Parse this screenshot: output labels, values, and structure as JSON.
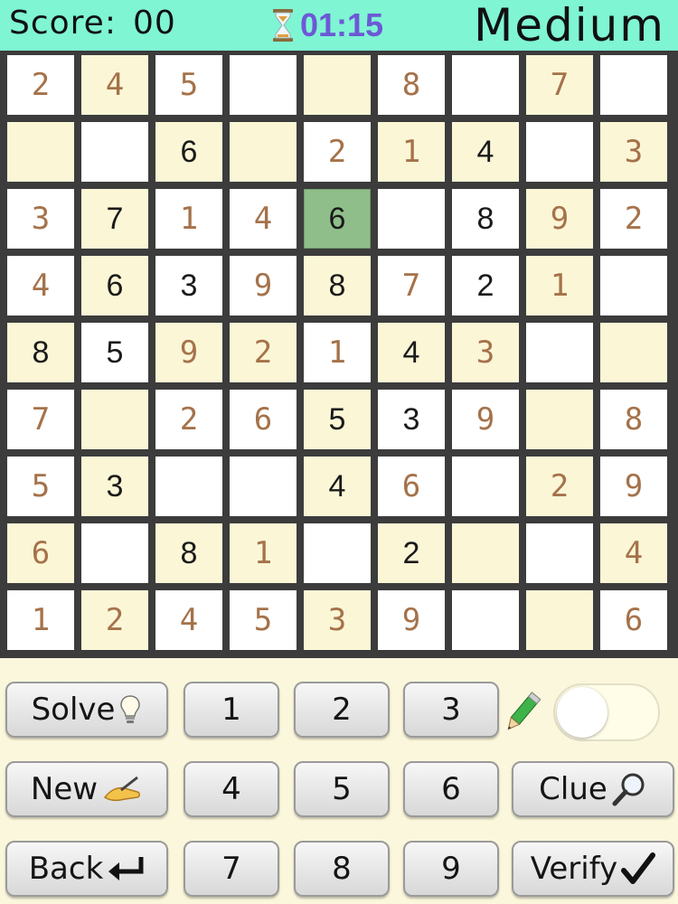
{
  "header": {
    "score_label": "Score:",
    "score_value": "00",
    "timer": "01:15",
    "difficulty": "Medium"
  },
  "board": {
    "rows": [
      [
        {
          "v": "2",
          "t": "g"
        },
        {
          "v": "4",
          "t": "g"
        },
        {
          "v": "5",
          "t": "g"
        },
        {
          "v": "",
          "t": "e"
        },
        {
          "v": "",
          "t": "e"
        },
        {
          "v": "8",
          "t": "g"
        },
        {
          "v": "",
          "t": "e"
        },
        {
          "v": "7",
          "t": "g"
        },
        {
          "v": "",
          "t": "e"
        }
      ],
      [
        {
          "v": "",
          "t": "e"
        },
        {
          "v": "",
          "t": "e"
        },
        {
          "v": "6",
          "t": "u"
        },
        {
          "v": "",
          "t": "e"
        },
        {
          "v": "2",
          "t": "g"
        },
        {
          "v": "1",
          "t": "g"
        },
        {
          "v": "4",
          "t": "u"
        },
        {
          "v": "",
          "t": "e"
        },
        {
          "v": "3",
          "t": "g"
        }
      ],
      [
        {
          "v": "3",
          "t": "g"
        },
        {
          "v": "7",
          "t": "u"
        },
        {
          "v": "1",
          "t": "g"
        },
        {
          "v": "4",
          "t": "g"
        },
        {
          "v": "6",
          "t": "u",
          "sel": true
        },
        {
          "v": "",
          "t": "e"
        },
        {
          "v": "8",
          "t": "u"
        },
        {
          "v": "9",
          "t": "g"
        },
        {
          "v": "2",
          "t": "g"
        }
      ],
      [
        {
          "v": "4",
          "t": "g"
        },
        {
          "v": "6",
          "t": "u"
        },
        {
          "v": "3",
          "t": "u"
        },
        {
          "v": "9",
          "t": "g"
        },
        {
          "v": "8",
          "t": "u"
        },
        {
          "v": "7",
          "t": "g"
        },
        {
          "v": "2",
          "t": "u"
        },
        {
          "v": "1",
          "t": "g"
        },
        {
          "v": "",
          "t": "e"
        }
      ],
      [
        {
          "v": "8",
          "t": "u"
        },
        {
          "v": "5",
          "t": "u"
        },
        {
          "v": "9",
          "t": "g"
        },
        {
          "v": "2",
          "t": "g"
        },
        {
          "v": "1",
          "t": "g"
        },
        {
          "v": "4",
          "t": "u"
        },
        {
          "v": "3",
          "t": "g"
        },
        {
          "v": "",
          "t": "e"
        },
        {
          "v": "",
          "t": "e"
        }
      ],
      [
        {
          "v": "7",
          "t": "g"
        },
        {
          "v": "",
          "t": "e"
        },
        {
          "v": "2",
          "t": "g"
        },
        {
          "v": "6",
          "t": "g"
        },
        {
          "v": "5",
          "t": "u"
        },
        {
          "v": "3",
          "t": "u"
        },
        {
          "v": "9",
          "t": "g"
        },
        {
          "v": "",
          "t": "e"
        },
        {
          "v": "8",
          "t": "g"
        }
      ],
      [
        {
          "v": "5",
          "t": "g"
        },
        {
          "v": "3",
          "t": "u"
        },
        {
          "v": "",
          "t": "e"
        },
        {
          "v": "",
          "t": "e"
        },
        {
          "v": "4",
          "t": "u"
        },
        {
          "v": "6",
          "t": "g"
        },
        {
          "v": "",
          "t": "e"
        },
        {
          "v": "2",
          "t": "g"
        },
        {
          "v": "9",
          "t": "g"
        }
      ],
      [
        {
          "v": "6",
          "t": "g"
        },
        {
          "v": "",
          "t": "e"
        },
        {
          "v": "8",
          "t": "u"
        },
        {
          "v": "1",
          "t": "g"
        },
        {
          "v": "",
          "t": "e"
        },
        {
          "v": "2",
          "t": "u"
        },
        {
          "v": "",
          "t": "e"
        },
        {
          "v": "",
          "t": "e"
        },
        {
          "v": "4",
          "t": "g"
        }
      ],
      [
        {
          "v": "1",
          "t": "g"
        },
        {
          "v": "2",
          "t": "g"
        },
        {
          "v": "4",
          "t": "g"
        },
        {
          "v": "5",
          "t": "g"
        },
        {
          "v": "3",
          "t": "g"
        },
        {
          "v": "9",
          "t": "g"
        },
        {
          "v": "",
          "t": "e"
        },
        {
          "v": "",
          "t": "e"
        },
        {
          "v": "6",
          "t": "g"
        }
      ]
    ]
  },
  "controls": {
    "solve_label": "Solve",
    "new_label": "New",
    "back_label": "Back",
    "clue_label": "Clue",
    "verify_label": "Verify",
    "numbers": [
      "1",
      "2",
      "3",
      "4",
      "5",
      "6",
      "7",
      "8",
      "9"
    ],
    "pencil_mode": false
  },
  "icons": {
    "timer": "hourglass-icon",
    "solve": "lightbulb-icon",
    "new": "writing-hand-icon",
    "back": "return-arrow-icon",
    "clue": "magnifier-icon",
    "verify": "checkmark-icon",
    "pencil": "pencil-icon"
  },
  "colors": {
    "header_bg": "#7ff5d4",
    "timer_text": "#6d58d6",
    "given_digit": "#a5724a",
    "selected_cell": "#8fbe8a"
  }
}
